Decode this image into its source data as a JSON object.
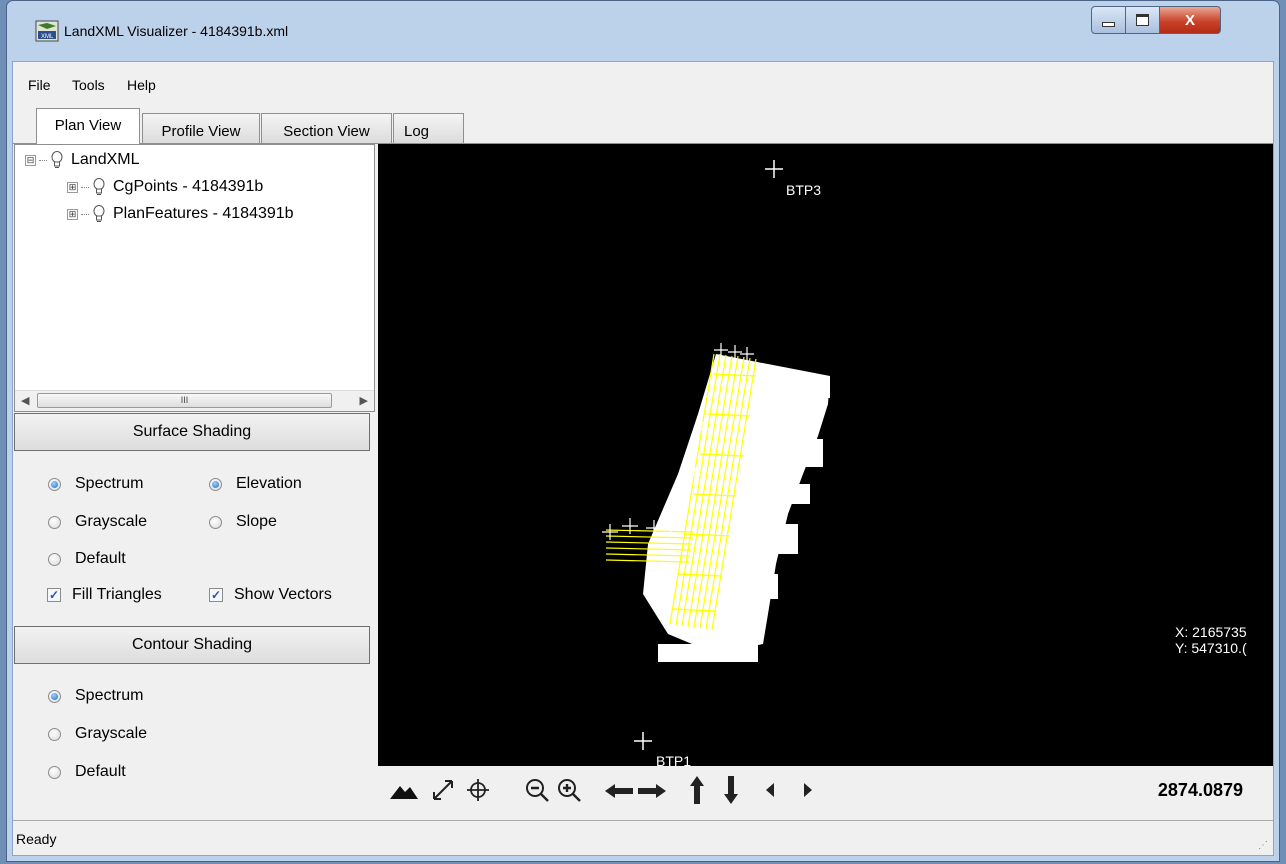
{
  "window": {
    "title": "LandXML Visualizer - 4184391b.xml",
    "close_glyph": "X",
    "colors": {
      "frame": "#bcd1ea",
      "close": "#c9432a",
      "plot_background": "#000000",
      "plot_lines": "#ffff00"
    }
  },
  "menu": {
    "items": [
      "File",
      "Tools",
      "Help"
    ]
  },
  "tabs": [
    {
      "label": "Plan View",
      "active": true
    },
    {
      "label": "Profile View",
      "active": false
    },
    {
      "label": "Section View",
      "active": false
    },
    {
      "label": "Log",
      "active": false
    }
  ],
  "tree": {
    "items": [
      {
        "label": "LandXML",
        "expander": "⊟",
        "icon": "lightbulb-icon"
      },
      {
        "label": "CgPoints - 4184391b",
        "expander": "⊞",
        "icon": "lightbulb-icon"
      },
      {
        "label": "PlanFeatures - 4184391b",
        "expander": "⊞",
        "icon": "lightbulb-icon"
      }
    ],
    "scroll_thumb_grip": "III"
  },
  "surface_shading": {
    "title": "Surface Shading",
    "options": [
      {
        "label": "Spectrum",
        "checked": true
      },
      {
        "label": "Elevation",
        "checked": true
      },
      {
        "label": "Grayscale",
        "checked": false
      },
      {
        "label": "Slope",
        "checked": false
      },
      {
        "label": "Default",
        "checked": false
      }
    ],
    "checkboxes": [
      {
        "label": "Fill Triangles",
        "checked": true
      },
      {
        "label": "Show Vectors",
        "checked": true
      }
    ]
  },
  "contour_shading": {
    "title": "Contour Shading",
    "options": [
      {
        "label": "Spectrum",
        "checked": true
      },
      {
        "label": "Grayscale",
        "checked": false
      },
      {
        "label": "Default",
        "checked": false
      }
    ]
  },
  "viewport": {
    "points": [
      {
        "label": "BTP3"
      },
      {
        "label": "BTP1"
      }
    ],
    "coords": {
      "x": "X: 2165735",
      "y": "Y: 547310.("
    }
  },
  "toolbar": {
    "tools": [
      "terrain-icon",
      "zoom-extents-icon",
      "crosshair-icon",
      "zoom-out-icon",
      "zoom-in-icon",
      "pan-left-icon",
      "pan-right-icon",
      "pan-up-icon",
      "pan-down-icon",
      "prev-icon",
      "next-icon"
    ],
    "scale": "2874.0879"
  },
  "status": {
    "text": "Ready"
  }
}
